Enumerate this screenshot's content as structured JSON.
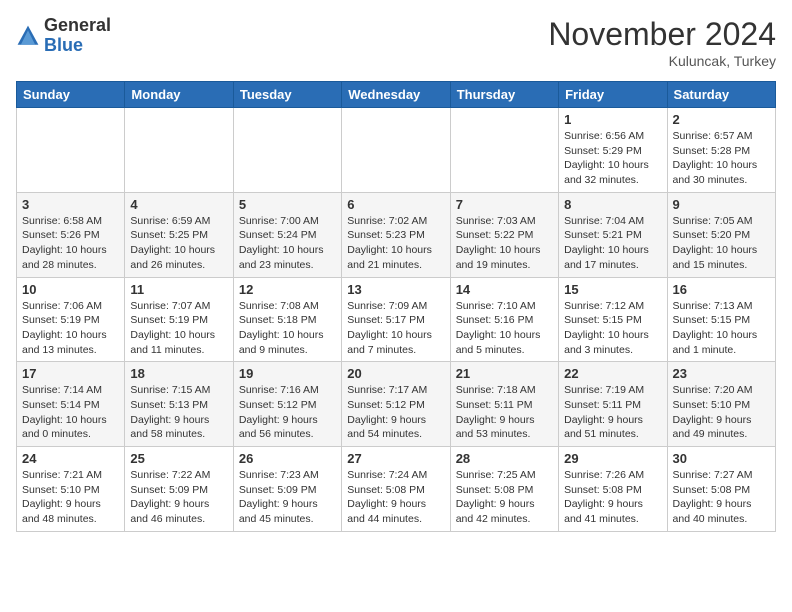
{
  "header": {
    "logo_general": "General",
    "logo_blue": "Blue",
    "month_title": "November 2024",
    "location": "Kuluncak, Turkey"
  },
  "weekdays": [
    "Sunday",
    "Monday",
    "Tuesday",
    "Wednesday",
    "Thursday",
    "Friday",
    "Saturday"
  ],
  "weeks": [
    [
      {
        "day": "",
        "info": ""
      },
      {
        "day": "",
        "info": ""
      },
      {
        "day": "",
        "info": ""
      },
      {
        "day": "",
        "info": ""
      },
      {
        "day": "",
        "info": ""
      },
      {
        "day": "1",
        "info": "Sunrise: 6:56 AM\nSunset: 5:29 PM\nDaylight: 10 hours and 32 minutes."
      },
      {
        "day": "2",
        "info": "Sunrise: 6:57 AM\nSunset: 5:28 PM\nDaylight: 10 hours and 30 minutes."
      }
    ],
    [
      {
        "day": "3",
        "info": "Sunrise: 6:58 AM\nSunset: 5:26 PM\nDaylight: 10 hours and 28 minutes."
      },
      {
        "day": "4",
        "info": "Sunrise: 6:59 AM\nSunset: 5:25 PM\nDaylight: 10 hours and 26 minutes."
      },
      {
        "day": "5",
        "info": "Sunrise: 7:00 AM\nSunset: 5:24 PM\nDaylight: 10 hours and 23 minutes."
      },
      {
        "day": "6",
        "info": "Sunrise: 7:02 AM\nSunset: 5:23 PM\nDaylight: 10 hours and 21 minutes."
      },
      {
        "day": "7",
        "info": "Sunrise: 7:03 AM\nSunset: 5:22 PM\nDaylight: 10 hours and 19 minutes."
      },
      {
        "day": "8",
        "info": "Sunrise: 7:04 AM\nSunset: 5:21 PM\nDaylight: 10 hours and 17 minutes."
      },
      {
        "day": "9",
        "info": "Sunrise: 7:05 AM\nSunset: 5:20 PM\nDaylight: 10 hours and 15 minutes."
      }
    ],
    [
      {
        "day": "10",
        "info": "Sunrise: 7:06 AM\nSunset: 5:19 PM\nDaylight: 10 hours and 13 minutes."
      },
      {
        "day": "11",
        "info": "Sunrise: 7:07 AM\nSunset: 5:19 PM\nDaylight: 10 hours and 11 minutes."
      },
      {
        "day": "12",
        "info": "Sunrise: 7:08 AM\nSunset: 5:18 PM\nDaylight: 10 hours and 9 minutes."
      },
      {
        "day": "13",
        "info": "Sunrise: 7:09 AM\nSunset: 5:17 PM\nDaylight: 10 hours and 7 minutes."
      },
      {
        "day": "14",
        "info": "Sunrise: 7:10 AM\nSunset: 5:16 PM\nDaylight: 10 hours and 5 minutes."
      },
      {
        "day": "15",
        "info": "Sunrise: 7:12 AM\nSunset: 5:15 PM\nDaylight: 10 hours and 3 minutes."
      },
      {
        "day": "16",
        "info": "Sunrise: 7:13 AM\nSunset: 5:15 PM\nDaylight: 10 hours and 1 minute."
      }
    ],
    [
      {
        "day": "17",
        "info": "Sunrise: 7:14 AM\nSunset: 5:14 PM\nDaylight: 10 hours and 0 minutes."
      },
      {
        "day": "18",
        "info": "Sunrise: 7:15 AM\nSunset: 5:13 PM\nDaylight: 9 hours and 58 minutes."
      },
      {
        "day": "19",
        "info": "Sunrise: 7:16 AM\nSunset: 5:12 PM\nDaylight: 9 hours and 56 minutes."
      },
      {
        "day": "20",
        "info": "Sunrise: 7:17 AM\nSunset: 5:12 PM\nDaylight: 9 hours and 54 minutes."
      },
      {
        "day": "21",
        "info": "Sunrise: 7:18 AM\nSunset: 5:11 PM\nDaylight: 9 hours and 53 minutes."
      },
      {
        "day": "22",
        "info": "Sunrise: 7:19 AM\nSunset: 5:11 PM\nDaylight: 9 hours and 51 minutes."
      },
      {
        "day": "23",
        "info": "Sunrise: 7:20 AM\nSunset: 5:10 PM\nDaylight: 9 hours and 49 minutes."
      }
    ],
    [
      {
        "day": "24",
        "info": "Sunrise: 7:21 AM\nSunset: 5:10 PM\nDaylight: 9 hours and 48 minutes."
      },
      {
        "day": "25",
        "info": "Sunrise: 7:22 AM\nSunset: 5:09 PM\nDaylight: 9 hours and 46 minutes."
      },
      {
        "day": "26",
        "info": "Sunrise: 7:23 AM\nSunset: 5:09 PM\nDaylight: 9 hours and 45 minutes."
      },
      {
        "day": "27",
        "info": "Sunrise: 7:24 AM\nSunset: 5:08 PM\nDaylight: 9 hours and 44 minutes."
      },
      {
        "day": "28",
        "info": "Sunrise: 7:25 AM\nSunset: 5:08 PM\nDaylight: 9 hours and 42 minutes."
      },
      {
        "day": "29",
        "info": "Sunrise: 7:26 AM\nSunset: 5:08 PM\nDaylight: 9 hours and 41 minutes."
      },
      {
        "day": "30",
        "info": "Sunrise: 7:27 AM\nSunset: 5:08 PM\nDaylight: 9 hours and 40 minutes."
      }
    ]
  ]
}
